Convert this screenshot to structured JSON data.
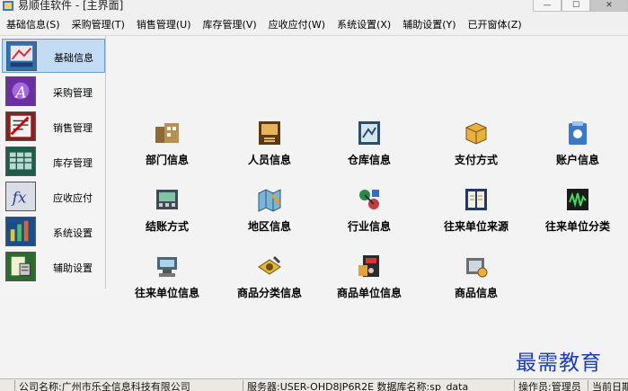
{
  "window": {
    "title": "易顺佳软件 - [主界面]",
    "controls": {
      "minimize": "—",
      "maximize": "☐",
      "close": "✕"
    }
  },
  "menu": [
    "基础信息(S)",
    "采购管理(T)",
    "销售管理(U)",
    "库存管理(V)",
    "应收应付(W)",
    "系统设置(X)",
    "辅助设置(Y)",
    "已开窗体(Z)"
  ],
  "sidebar": {
    "items": [
      {
        "label": "基础信息",
        "icon": "basic-info-icon",
        "active": true
      },
      {
        "label": "采购管理",
        "icon": "purchase-icon",
        "active": false
      },
      {
        "label": "销售管理",
        "icon": "sales-icon",
        "active": false
      },
      {
        "label": "库存管理",
        "icon": "inventory-icon",
        "active": false
      },
      {
        "label": "应收应付",
        "icon": "receivable-payable-icon",
        "active": false
      },
      {
        "label": "系统设置",
        "icon": "system-settings-icon",
        "active": false
      },
      {
        "label": "辅助设置",
        "icon": "aux-settings-icon",
        "active": false
      }
    ]
  },
  "modules": [
    {
      "label": "部门信息",
      "icon": "department-icon"
    },
    {
      "label": "人员信息",
      "icon": "personnel-icon"
    },
    {
      "label": "仓库信息",
      "icon": "warehouse-icon"
    },
    {
      "label": "支付方式",
      "icon": "payment-method-icon"
    },
    {
      "label": "账户信息",
      "icon": "account-icon"
    },
    {
      "label": "结账方式",
      "icon": "settlement-icon"
    },
    {
      "label": "地区信息",
      "icon": "region-icon"
    },
    {
      "label": "行业信息",
      "icon": "industry-icon"
    },
    {
      "label": "往来单位来源",
      "icon": "partner-source-icon"
    },
    {
      "label": "往来单位分类",
      "icon": "partner-category-icon"
    },
    {
      "label": "往来单位信息",
      "icon": "partner-info-icon"
    },
    {
      "label": "商品分类信息",
      "icon": "product-category-icon"
    },
    {
      "label": "商品单位信息",
      "icon": "product-unit-icon"
    },
    {
      "label": "商品信息",
      "icon": "product-info-icon"
    }
  ],
  "status": {
    "company": "公司名称:广州市乐全信息科技有限公司",
    "server": "服务器:USER-OHD8JP6R2E  数据库名称:sp_data",
    "operator": "操作员:管理员",
    "date": "当前日期"
  },
  "watermark": "最需教育"
}
